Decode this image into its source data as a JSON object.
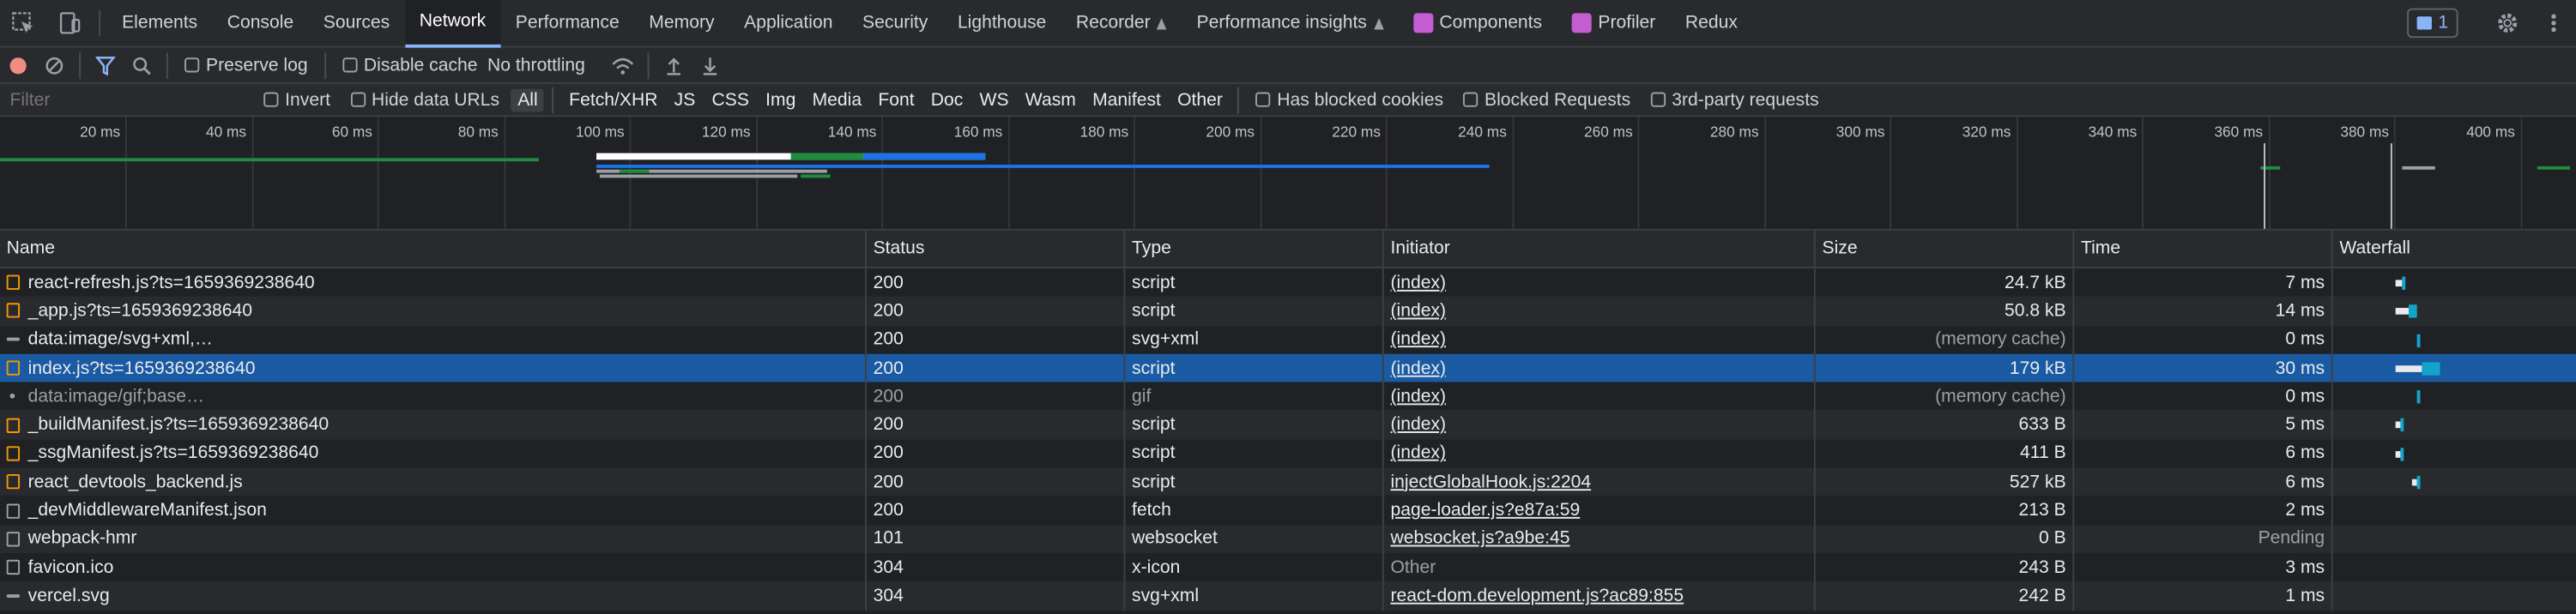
{
  "tabs": [
    "Elements",
    "Console",
    "Sources",
    "Network",
    "Performance",
    "Memory",
    "Application",
    "Security",
    "Lighthouse",
    "Recorder",
    "Performance insights",
    "Components",
    "Profiler",
    "Redux"
  ],
  "active_tab": "Network",
  "issues_count": "1",
  "toolbar": {
    "preserve_log": "Preserve log",
    "disable_cache": "Disable cache",
    "throttling": "No throttling"
  },
  "filter": {
    "placeholder": "Filter",
    "invert": "Invert",
    "hide_data_urls": "Hide data URLs",
    "types": [
      "All",
      "Fetch/XHR",
      "JS",
      "CSS",
      "Img",
      "Media",
      "Font",
      "Doc",
      "WS",
      "Wasm",
      "Manifest",
      "Other"
    ],
    "active_type": "All",
    "has_blocked_cookies": "Has blocked cookies",
    "blocked_requests": "Blocked Requests",
    "third_party": "3rd-party requests"
  },
  "overview": {
    "tick_labels": [
      "20 ms",
      "40 ms",
      "60 ms",
      "80 ms",
      "100 ms",
      "120 ms",
      "140 ms",
      "160 ms",
      "180 ms",
      "200 ms",
      "220 ms",
      "240 ms",
      "260 ms",
      "280 ms",
      "300 ms",
      "320 ms",
      "340 ms",
      "360 ms",
      "380 ms",
      "400 ms"
    ]
  },
  "table": {
    "columns": [
      "Name",
      "Status",
      "Type",
      "Initiator",
      "Size",
      "Time",
      "Waterfall"
    ],
    "rows": [
      {
        "name": "react-refresh.js?ts=1659369238640",
        "status": "200",
        "type": "script",
        "initiator": "(index)",
        "size": "24.7 kB",
        "time": "7 ms",
        "icon": "script-file-icon",
        "wf": [
          0.9,
          7
        ]
      },
      {
        "name": "_app.js?ts=1659369238640",
        "status": "200",
        "type": "script",
        "initiator": "(index)",
        "size": "50.8 kB",
        "time": "14 ms",
        "icon": "script-file-icon",
        "wf": [
          0.9,
          14
        ]
      },
      {
        "name": "data:image/svg+xml,…",
        "status": "200",
        "type": "svg+xml",
        "initiator": "(index)",
        "size": "(memory cache)",
        "time": "0 ms",
        "icon": "image-icon",
        "wf": [
          0.9,
          0
        ]
      },
      {
        "name": "index.js?ts=1659369238640",
        "status": "200",
        "type": "script",
        "initiator": "(index)",
        "size": "179 kB",
        "time": "30 ms",
        "icon": "script-file-icon",
        "wf": [
          0.9,
          30
        ],
        "selected": true
      },
      {
        "name": "data:image/gif;base…",
        "status": "200",
        "type": "gif",
        "initiator": "(index)",
        "size": "(memory cache)",
        "time": "0 ms",
        "icon": "dot-icon",
        "wf": [
          0.9,
          0
        ],
        "dim": true
      },
      {
        "name": "_buildManifest.js?ts=1659369238640",
        "status": "200",
        "type": "script",
        "initiator": "(index)",
        "size": "633 B",
        "time": "5 ms",
        "icon": "script-file-icon",
        "wf": [
          0.9,
          5
        ]
      },
      {
        "name": "_ssgManifest.js?ts=1659369238640",
        "status": "200",
        "type": "script",
        "initiator": "(index)",
        "size": "411 B",
        "time": "6 ms",
        "icon": "script-file-icon",
        "wf": [
          0.9,
          6
        ]
      },
      {
        "name": "react_devtools_backend.js",
        "status": "200",
        "type": "script",
        "initiator": "injectGlobalHook.js:2204",
        "size": "527 kB",
        "time": "6 ms",
        "icon": "script-file-icon",
        "wf": [
          1.0,
          6
        ]
      },
      {
        "name": "_devMiddlewareManifest.json",
        "status": "200",
        "type": "fetch",
        "initiator": "page-loader.js?e87a:59",
        "size": "213 B",
        "time": "2 ms",
        "icon": "doc-icon",
        "wf": null
      },
      {
        "name": "webpack-hmr",
        "status": "101",
        "type": "websocket",
        "initiator": "websocket.js?a9be:45",
        "size": "0 B",
        "time": "Pending",
        "icon": "doc-icon",
        "wf": null,
        "time_muted": true
      },
      {
        "name": "favicon.ico",
        "status": "304",
        "type": "x-icon",
        "initiator": "Other",
        "size": "243 B",
        "time": "3 ms",
        "icon": "doc-icon",
        "wf": null,
        "init_plain": true
      },
      {
        "name": "vercel.svg",
        "status": "304",
        "type": "svg+xml",
        "initiator": "react-dom.development.js?ac89:855",
        "size": "242 B",
        "time": "1 ms",
        "icon": "image-icon",
        "wf": null
      }
    ]
  },
  "colors": {
    "accent": "#8ab4f8",
    "selected": "#1a5aa3",
    "script": "#f29900"
  }
}
